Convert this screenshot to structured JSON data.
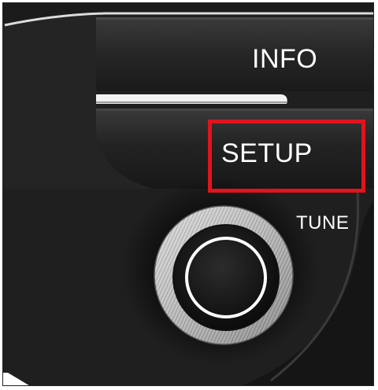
{
  "panel": {
    "buttons": [
      {
        "id": "info",
        "label": "INFO"
      },
      {
        "id": "setup",
        "label": "SETUP",
        "highlighted": true
      }
    ],
    "knob": {
      "label": "TUNE"
    }
  },
  "colors": {
    "panel": "#1e1e1e",
    "button_face": "#2b2b2b",
    "highlight": "#e0141c",
    "text": "#ffffff"
  }
}
